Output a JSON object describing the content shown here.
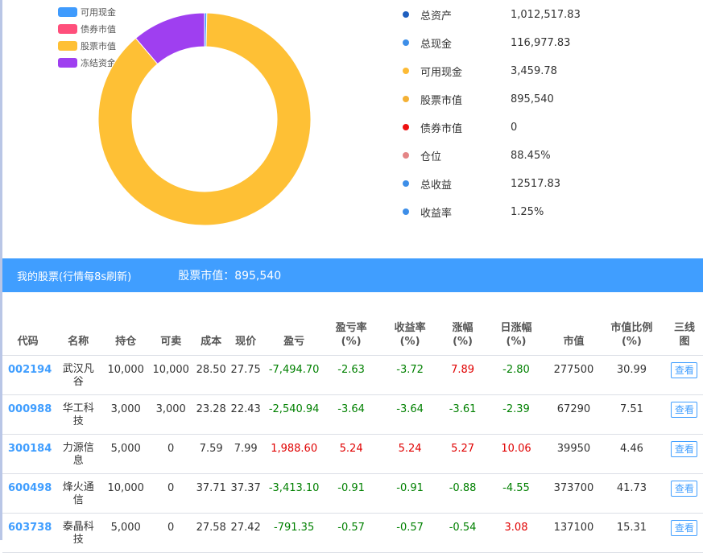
{
  "legend": [
    {
      "label": "可用现金",
      "color": "#3f9bfd"
    },
    {
      "label": "债券市值",
      "color": "#ff4f7b"
    },
    {
      "label": "股票市值",
      "color": "#fec035"
    },
    {
      "label": "冻结资金",
      "color": "#9f3ff0"
    }
  ],
  "chart_data": {
    "type": "pie",
    "categories": [
      "可用现金",
      "债券市值",
      "股票市值",
      "冻结资金"
    ],
    "values": [
      3459.78,
      0,
      895540,
      113518.05
    ]
  },
  "summary": [
    {
      "label": "总资产",
      "value": "1,012,517.83",
      "color": "#1f5fbf"
    },
    {
      "label": "总现金",
      "value": "116,977.83",
      "color": "#3d8ee8"
    },
    {
      "label": "可用现金",
      "value": "3,459.78",
      "color": "#fdbb35"
    },
    {
      "label": "股票市值",
      "value": "895,540",
      "color": "#f4b135"
    },
    {
      "label": "债券市值",
      "value": "0",
      "color": "#ee1010"
    },
    {
      "label": "仓位",
      "value": "88.45%",
      "color": "#e48586"
    },
    {
      "label": "总收益",
      "value": "12517.83",
      "color": "#3d8ee8"
    },
    {
      "label": "收益率",
      "value": "1.25%",
      "color": "#3d8ee8"
    }
  ],
  "bar": {
    "title": "我的股票(行情每8s刷新)",
    "market_value_label": "股票市值：895,540"
  },
  "table": {
    "headers": [
      "代码",
      "名称",
      "持仓",
      "可卖",
      "成本",
      "现价",
      "盈亏",
      "盈亏率\n(%)",
      "收益率\n(%)",
      "涨幅\n(%)",
      "日涨幅\n(%)",
      "市值",
      "市值比例\n(%)",
      "三线\n图"
    ],
    "view_label": "查看",
    "rows": [
      {
        "code": "002194",
        "name": "武汉凡\n谷",
        "hold": "10,000",
        "sell": "10,000",
        "cost": "28.50",
        "price": "27.75",
        "pl": "-7,494.70",
        "plr": "-2.63",
        "ret": "-3.72",
        "chg": "7.89",
        "dchg": "-2.80",
        "mv": "277500",
        "mvr": "30.99"
      },
      {
        "code": "000988",
        "name": "华工科\n技",
        "hold": "3,000",
        "sell": "3,000",
        "cost": "23.28",
        "price": "22.43",
        "pl": "-2,540.94",
        "plr": "-3.64",
        "ret": "-3.64",
        "chg": "-3.61",
        "dchg": "-2.39",
        "mv": "67290",
        "mvr": "7.51"
      },
      {
        "code": "300184",
        "name": "力源信\n息",
        "hold": "5,000",
        "sell": "0",
        "cost": "7.59",
        "price": "7.99",
        "pl": "1,988.60",
        "plr": "5.24",
        "ret": "5.24",
        "chg": "5.27",
        "dchg": "10.06",
        "mv": "39950",
        "mvr": "4.46"
      },
      {
        "code": "600498",
        "name": "烽火通\n信",
        "hold": "10,000",
        "sell": "0",
        "cost": "37.71",
        "price": "37.37",
        "pl": "-3,413.10",
        "plr": "-0.91",
        "ret": "-0.91",
        "chg": "-0.88",
        "dchg": "-4.55",
        "mv": "373700",
        "mvr": "41.73"
      },
      {
        "code": "603738",
        "name": "泰晶科\n技",
        "hold": "5,000",
        "sell": "0",
        "cost": "27.58",
        "price": "27.42",
        "pl": "-791.35",
        "plr": "-0.57",
        "ret": "-0.57",
        "chg": "-0.54",
        "dchg": "3.08",
        "mv": "137100",
        "mvr": "15.31"
      }
    ]
  }
}
